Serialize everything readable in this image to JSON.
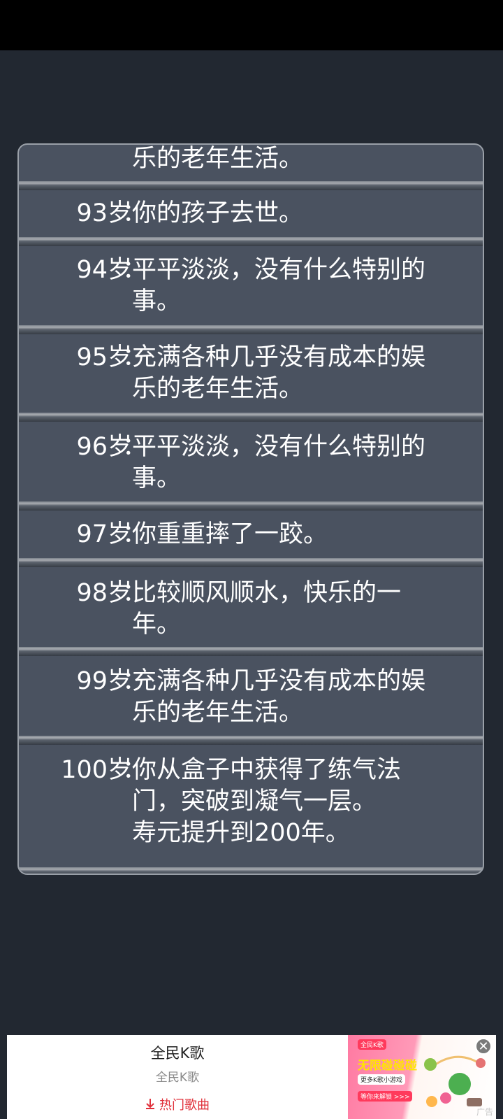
{
  "entries": [
    {
      "age": "",
      "lines": [
        "乐的老年生活。"
      ]
    },
    {
      "age": "93岁",
      "lines": [
        "你的孩子去世。"
      ]
    },
    {
      "age": "94岁",
      "lines": [
        "平平淡淡，没有什么特别的",
        "事。"
      ]
    },
    {
      "age": "95岁",
      "lines": [
        "充满各种几乎没有成本的娱",
        "乐的老年生活。"
      ]
    },
    {
      "age": "96岁",
      "lines": [
        "平平淡淡，没有什么特别的",
        "事。"
      ]
    },
    {
      "age": "97岁",
      "lines": [
        "你重重摔了一跤。"
      ]
    },
    {
      "age": "98岁",
      "lines": [
        "比较顺风顺水，快乐的一",
        "年。"
      ]
    },
    {
      "age": "99岁",
      "lines": [
        "充满各种几乎没有成本的娱",
        "乐的老年生活。"
      ]
    },
    {
      "age": "100岁",
      "lines": [
        "你从盒子中获得了练气法",
        "门，突破到凝气一层。",
        "寿元提升到200年。"
      ]
    }
  ],
  "colon": "：",
  "ad": {
    "title": "全民K歌",
    "subtitle": "全民K歌",
    "cta": "热门歌曲",
    "image_tag1": "全民K歌",
    "image_headline": "无限碰碰碰",
    "image_sub": "更多K歌小游戏",
    "image_cta": "等你来解锁 >>>",
    "badge": "广告",
    "close": "✕"
  }
}
